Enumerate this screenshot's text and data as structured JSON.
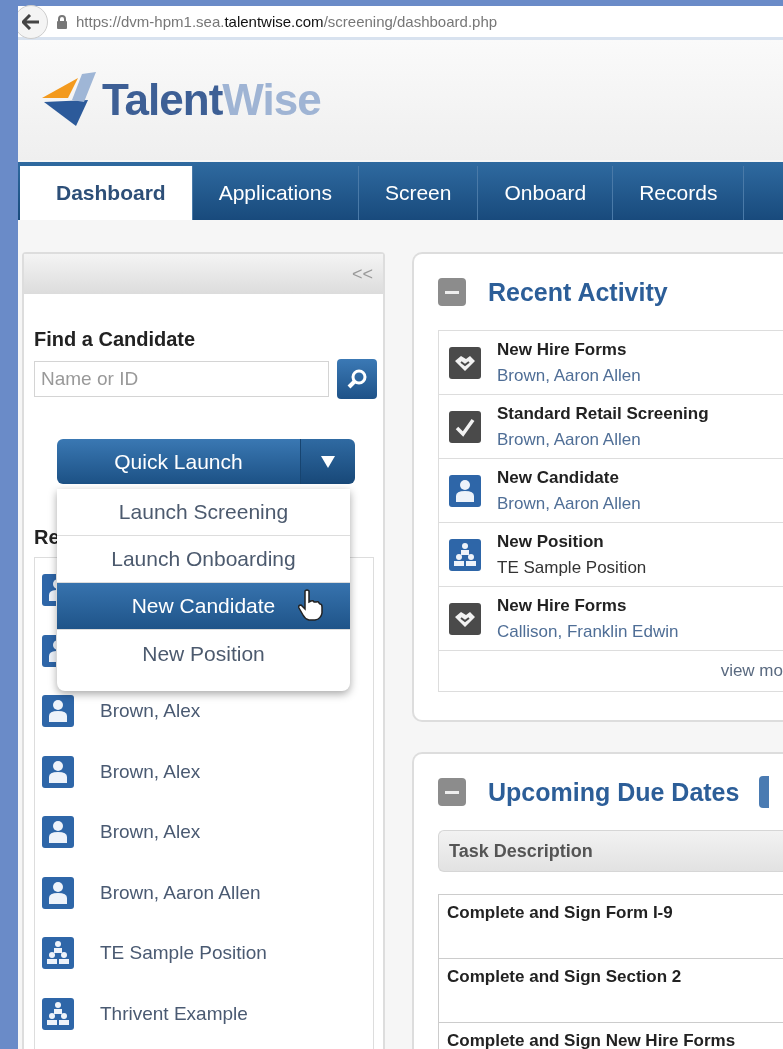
{
  "browser": {
    "url": "https://dvm-hpm1.sea.**talentwise.com**/screening/dashboard.php"
  },
  "logo": {
    "part_1": "Talent",
    "part_2": "Wise"
  },
  "tabs": [
    {
      "label": "Dashboard",
      "selected": true
    },
    {
      "label": "Applications",
      "selected": false
    },
    {
      "label": "Screen",
      "selected": false
    },
    {
      "label": "Onboard",
      "selected": false
    },
    {
      "label": "Records",
      "selected": false
    }
  ],
  "sidebar": {
    "collapse": "<<",
    "find_title": "Find a Candidate",
    "search": {
      "placeholder": "Name or ID"
    },
    "quick_launch": {
      "label": "Quick Launch",
      "expanded": true,
      "menu": [
        {
          "label": "Launch Screening",
          "selected": false
        },
        {
          "label": "Launch Onboarding",
          "selected": false
        },
        {
          "label": "New Candidate",
          "selected": true
        },
        {
          "label": "New Position",
          "selected": false
        }
      ]
    },
    "recent_heading": "Re",
    "recent": [
      {
        "kind": "person"
      },
      {
        "kind": "person"
      },
      {
        "kind": "person",
        "label": "Brown, Alex"
      },
      {
        "kind": "person",
        "label": "Brown, Alex"
      },
      {
        "kind": "person",
        "label": "Brown, Alex"
      },
      {
        "kind": "person",
        "label": "Brown, Aaron Allen"
      },
      {
        "kind": "position",
        "label": "TE Sample Position"
      },
      {
        "kind": "position",
        "label": "Thrivent Example"
      }
    ]
  },
  "recent_activity": {
    "title": "Recent Activity",
    "items": [
      {
        "kind": "forms",
        "title": "New Hire Forms",
        "subtitle": "Brown, Aaron Allen",
        "link": true
      },
      {
        "kind": "screening",
        "title": "Standard Retail Screening",
        "subtitle": "Brown, Aaron Allen",
        "link": true
      },
      {
        "kind": "person",
        "title": "New Candidate",
        "subtitle": "Brown, Aaron Allen",
        "link": true
      },
      {
        "kind": "position",
        "title": "New Position",
        "subtitle": "TE Sample Position",
        "link": false
      },
      {
        "kind": "forms",
        "title": "New Hire Forms",
        "subtitle": "Callison, Franklin Edwin",
        "link": true
      }
    ],
    "more": "view mo"
  },
  "upcoming": {
    "title": "Upcoming Due Dates",
    "columns": [
      "Task Description"
    ],
    "rows": [
      "Complete and Sign Form I-9",
      "Complete and Sign Section 2",
      "Complete and Sign New Hire Forms"
    ]
  }
}
